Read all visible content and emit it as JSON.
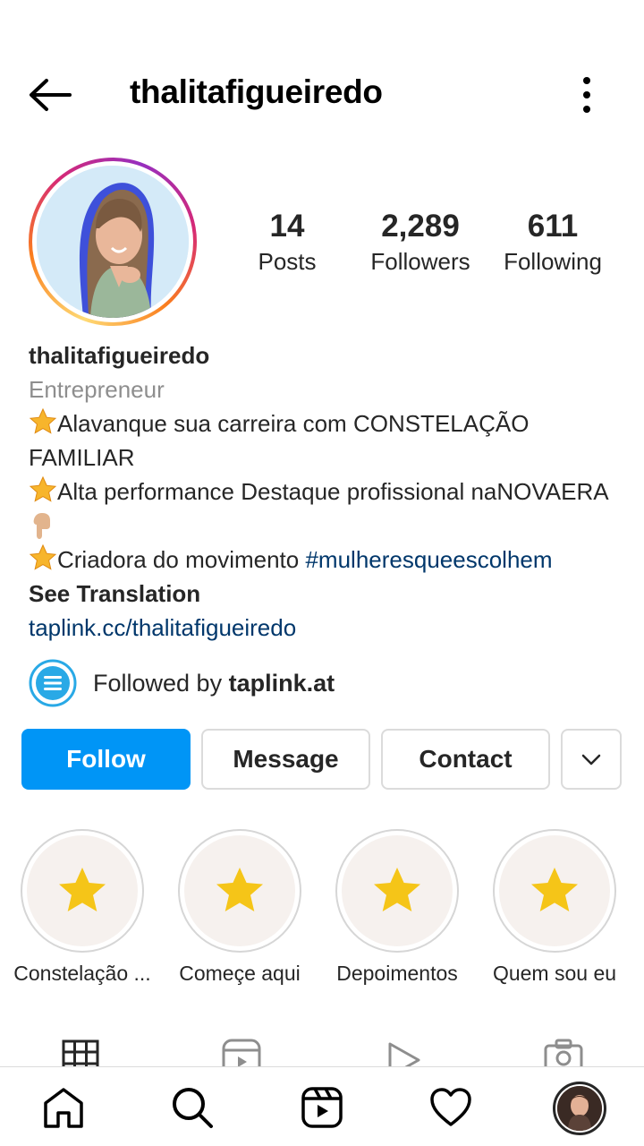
{
  "header": {
    "username": "thalitafigueiredo"
  },
  "stats": {
    "posts": {
      "value": "14",
      "label": "Posts"
    },
    "followers": {
      "value": "2,289",
      "label": "Followers"
    },
    "following": {
      "value": "611",
      "label": "Following"
    }
  },
  "bio": {
    "name": "thalitafigueiredo",
    "category": "Entrepreneur",
    "line1": "Alavanque sua carreira com CONSTELAÇÃO FAMILIAR",
    "line2": "Alta performance Destaque profissional naNOVAERA",
    "line3_text": "Criadora do movimento ",
    "line3_hashtag": "#mulheresqueescolhem",
    "see_translation": "See Translation",
    "link": "taplink.cc/thalitafigueiredo"
  },
  "followed_by": {
    "prefix": "Followed by ",
    "account": "taplink.at"
  },
  "actions": {
    "follow": "Follow",
    "message": "Message",
    "contact": "Contact"
  },
  "highlights": [
    {
      "label": "Constelação ..."
    },
    {
      "label": "Começe aqui"
    },
    {
      "label": "Depoimentos"
    },
    {
      "label": "Quem sou eu"
    }
  ],
  "colors": {
    "accent_blue": "#0095f6",
    "link_blue": "#00376b",
    "muted_text": "#8e8e8e",
    "star_yellow": "#f5c518"
  },
  "icons": {
    "back": "arrow-left-icon",
    "more": "more-vertical-icon",
    "tabs": [
      "grid-icon",
      "reels-icon",
      "video-icon",
      "tagged-icon"
    ],
    "nav": [
      "home-icon",
      "search-icon",
      "reels-icon",
      "heart-icon",
      "profile-avatar"
    ]
  }
}
